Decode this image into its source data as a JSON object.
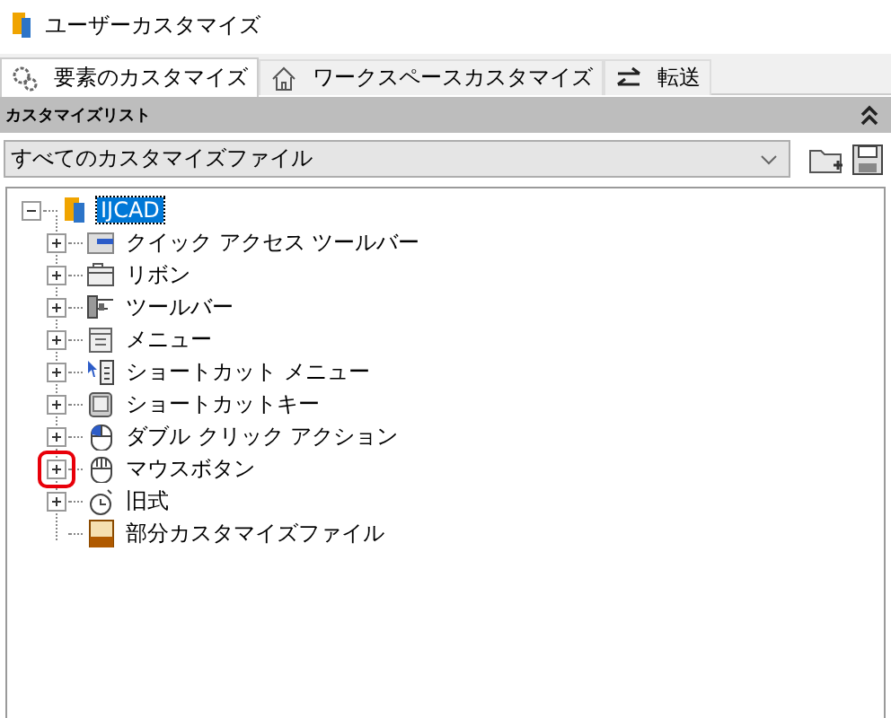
{
  "window": {
    "title": "ユーザーカスタマイズ"
  },
  "tabs": [
    {
      "label": "要素のカスタマイズ",
      "selected": true
    },
    {
      "label": "ワークスペースカスタマイズ",
      "selected": false
    },
    {
      "label": "転送",
      "selected": false
    }
  ],
  "panel": {
    "title": "カスタマイズリスト",
    "expanded": true
  },
  "file_select": {
    "value": "すべてのカスタマイズファイル"
  },
  "tree": [
    {
      "label": "IJCAD",
      "expanded": true,
      "selected": true,
      "children": [
        {
          "label": "クイック アクセス ツールバー",
          "expanded": false,
          "selected": false,
          "highlighted": false
        },
        {
          "label": "リボン",
          "expanded": false,
          "selected": false,
          "highlighted": false
        },
        {
          "label": "ツールバー",
          "expanded": false,
          "selected": false,
          "highlighted": false
        },
        {
          "label": "メニュー",
          "expanded": false,
          "selected": false,
          "highlighted": false
        },
        {
          "label": "ショートカット メニュー",
          "expanded": false,
          "selected": false,
          "highlighted": false
        },
        {
          "label": "ショートカットキー",
          "expanded": false,
          "selected": false,
          "highlighted": false
        },
        {
          "label": "ダブル クリック アクション",
          "expanded": false,
          "selected": false,
          "highlighted": false
        },
        {
          "label": "マウスボタン",
          "expanded": false,
          "selected": false,
          "highlighted": true
        },
        {
          "label": "旧式",
          "expanded": false,
          "selected": false,
          "highlighted": false
        },
        {
          "label": "部分カスタマイズファイル",
          "selected": false,
          "highlighted": false
        }
      ]
    }
  ]
}
